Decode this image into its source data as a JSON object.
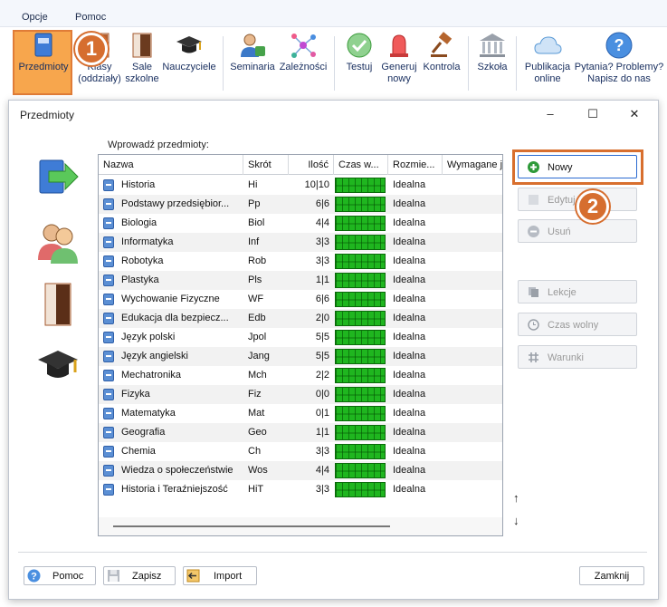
{
  "menu": [
    "Opcje",
    "Pomoc"
  ],
  "ribbon": {
    "items": [
      {
        "label": "Przedmioty",
        "icon": "subjects-book-icon"
      },
      {
        "label": "Klasy\n(oddziały)",
        "icon": "classes-door-icon"
      },
      {
        "label": "Sale\nszkolne",
        "icon": "rooms-door-icon"
      },
      {
        "label": "Nauczyciele",
        "icon": "teachers-graduation-cap-icon"
      },
      {
        "label": "Seminaria",
        "icon": "seminars-person-icon"
      },
      {
        "label": "Zależności",
        "icon": "dependencies-network-icon"
      },
      {
        "label": "Testuj",
        "icon": "test-check-icon"
      },
      {
        "label": "Generuj\nnowy",
        "icon": "generate-alarm-icon"
      },
      {
        "label": "Kontrola",
        "icon": "control-gavel-icon"
      },
      {
        "label": "Szkoła",
        "icon": "school-building-icon"
      },
      {
        "label": "Publikacja\nonline",
        "icon": "cloud-icon"
      },
      {
        "label": "Pytania? Problemy?\nNapisz do nas",
        "icon": "question-icon"
      }
    ]
  },
  "callouts": {
    "step1": "1",
    "step2": "2"
  },
  "dialog": {
    "title": "Przedmioty",
    "instruction": "Wprowadź przedmioty:",
    "columns": [
      "Nazwa",
      "Skrót",
      "Ilość",
      "Czas w...",
      "Rozmie...",
      "Wymagane j"
    ],
    "rows": [
      {
        "name": "Historia",
        "abbr": "Hi",
        "qty": "10|10",
        "size": "Idealna"
      },
      {
        "name": "Podstawy przedsiębior...",
        "abbr": "Pp",
        "qty": "6|6",
        "size": "Idealna"
      },
      {
        "name": "Biologia",
        "abbr": "Biol",
        "qty": "4|4",
        "size": "Idealna"
      },
      {
        "name": "Informatyka",
        "abbr": "Inf",
        "qty": "3|3",
        "size": "Idealna"
      },
      {
        "name": "Robotyka",
        "abbr": "Rob",
        "qty": "3|3",
        "size": "Idealna"
      },
      {
        "name": "Plastyka",
        "abbr": "Pls",
        "qty": "1|1",
        "size": "Idealna"
      },
      {
        "name": "Wychowanie Fizyczne",
        "abbr": "WF",
        "qty": "6|6",
        "size": "Idealna"
      },
      {
        "name": "Edukacja dla bezpiecz...",
        "abbr": "Edb",
        "qty": "2|0",
        "size": "Idealna"
      },
      {
        "name": "Język polski",
        "abbr": "Jpol",
        "qty": "5|5",
        "size": "Idealna"
      },
      {
        "name": "Język angielski",
        "abbr": "Jang",
        "qty": "5|5",
        "size": "Idealna"
      },
      {
        "name": "Mechatronika",
        "abbr": "Mch",
        "qty": "2|2",
        "size": "Idealna"
      },
      {
        "name": "Fizyka",
        "abbr": "Fiz",
        "qty": "0|0",
        "size": "Idealna"
      },
      {
        "name": "Matematyka",
        "abbr": "Mat",
        "qty": "0|1",
        "size": "Idealna"
      },
      {
        "name": "Geografia",
        "abbr": "Geo",
        "qty": "1|1",
        "size": "Idealna"
      },
      {
        "name": "Chemia",
        "abbr": "Ch",
        "qty": "3|3",
        "size": "Idealna"
      },
      {
        "name": "Wiedza o społeczeństwie",
        "abbr": "Wos",
        "qty": "4|4",
        "size": "Idealna"
      },
      {
        "name": "Historia i Teraźniejszość",
        "abbr": "HiT",
        "qty": "3|3",
        "size": "Idealna"
      }
    ],
    "side_buttons": {
      "new": "Nowy",
      "edit": "Edytuj",
      "delete": "Usuń",
      "lessons": "Lekcje",
      "free_time": "Czas wolny",
      "conditions": "Warunki"
    },
    "footer": {
      "help": "Pomoc",
      "save": "Zapisz",
      "import": "Import",
      "close": "Zamknij"
    }
  },
  "colors": {
    "accent": "#e07c37",
    "primary_border": "#2b6bd1",
    "time_fill": "#1fb61f"
  }
}
